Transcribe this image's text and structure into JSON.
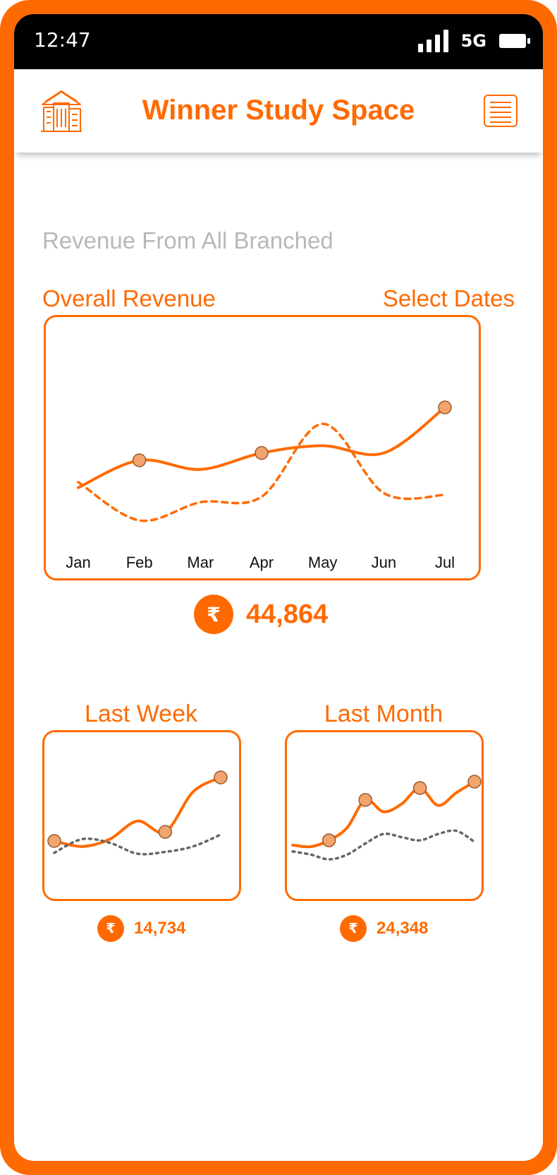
{
  "status_bar": {
    "time": "12:47",
    "network": "5G"
  },
  "header": {
    "title": "Winner Study Space",
    "logo_icon": "building-icon",
    "menu_icon": "hamburger-menu-icon"
  },
  "subtitle": "Revenue From All Branched",
  "overall": {
    "title": "Overall Revenue",
    "select_dates": "Select Dates",
    "currency_symbol": "₹",
    "total": "44,864"
  },
  "chart_data": [
    {
      "type": "line",
      "title": "Overall Revenue",
      "categories": [
        "Jan",
        "Feb",
        "Mar",
        "Apr",
        "May",
        "Jun",
        "Jul"
      ],
      "y_axis_shown": false,
      "grid": false,
      "series": [
        {
          "style": "solid",
          "values": [
            10,
            25,
            20,
            29,
            33,
            29,
            54
          ],
          "markers": [
            "Feb",
            "Apr",
            "Jul"
          ]
        },
        {
          "style": "dashed",
          "values": [
            13,
            -8,
            2,
            5,
            45,
            7,
            6
          ]
        }
      ]
    },
    {
      "type": "line",
      "title": "Last Week",
      "x_axis_shown": false,
      "y_axis_shown": false,
      "series": [
        {
          "style": "solid",
          "color": "#FF6A00",
          "values": [
            38,
            32,
            40,
            60,
            48,
            92,
            108
          ],
          "marker_indices": [
            0,
            4,
            6
          ]
        },
        {
          "style": "dotted",
          "color": "#666666",
          "values": [
            25,
            40,
            36,
            24,
            26,
            32,
            45
          ]
        }
      ]
    },
    {
      "type": "line",
      "title": "Last Month",
      "x_axis_shown": false,
      "y_axis_shown": false,
      "series": [
        {
          "style": "solid",
          "color": "#FF6A00",
          "values": [
            38,
            36,
            44,
            60,
            95,
            80,
            90,
            110,
            88,
            104,
            118
          ],
          "marker_indices": [
            2,
            4,
            7,
            10
          ]
        },
        {
          "style": "dotted",
          "color": "#666666",
          "values": [
            30,
            26,
            20,
            26,
            40,
            52,
            48,
            44,
            52,
            56,
            42
          ]
        }
      ]
    }
  ],
  "last_week": {
    "title": "Last Week",
    "currency_symbol": "₹",
    "total": "14,734"
  },
  "last_month": {
    "title": "Last Month",
    "currency_symbol": "₹",
    "total": "24,348"
  },
  "colors": {
    "accent": "#FF6A00",
    "marker_fill": "#F2A46F",
    "secondary_line": "#666666",
    "muted_text": "#B8B8B8"
  }
}
